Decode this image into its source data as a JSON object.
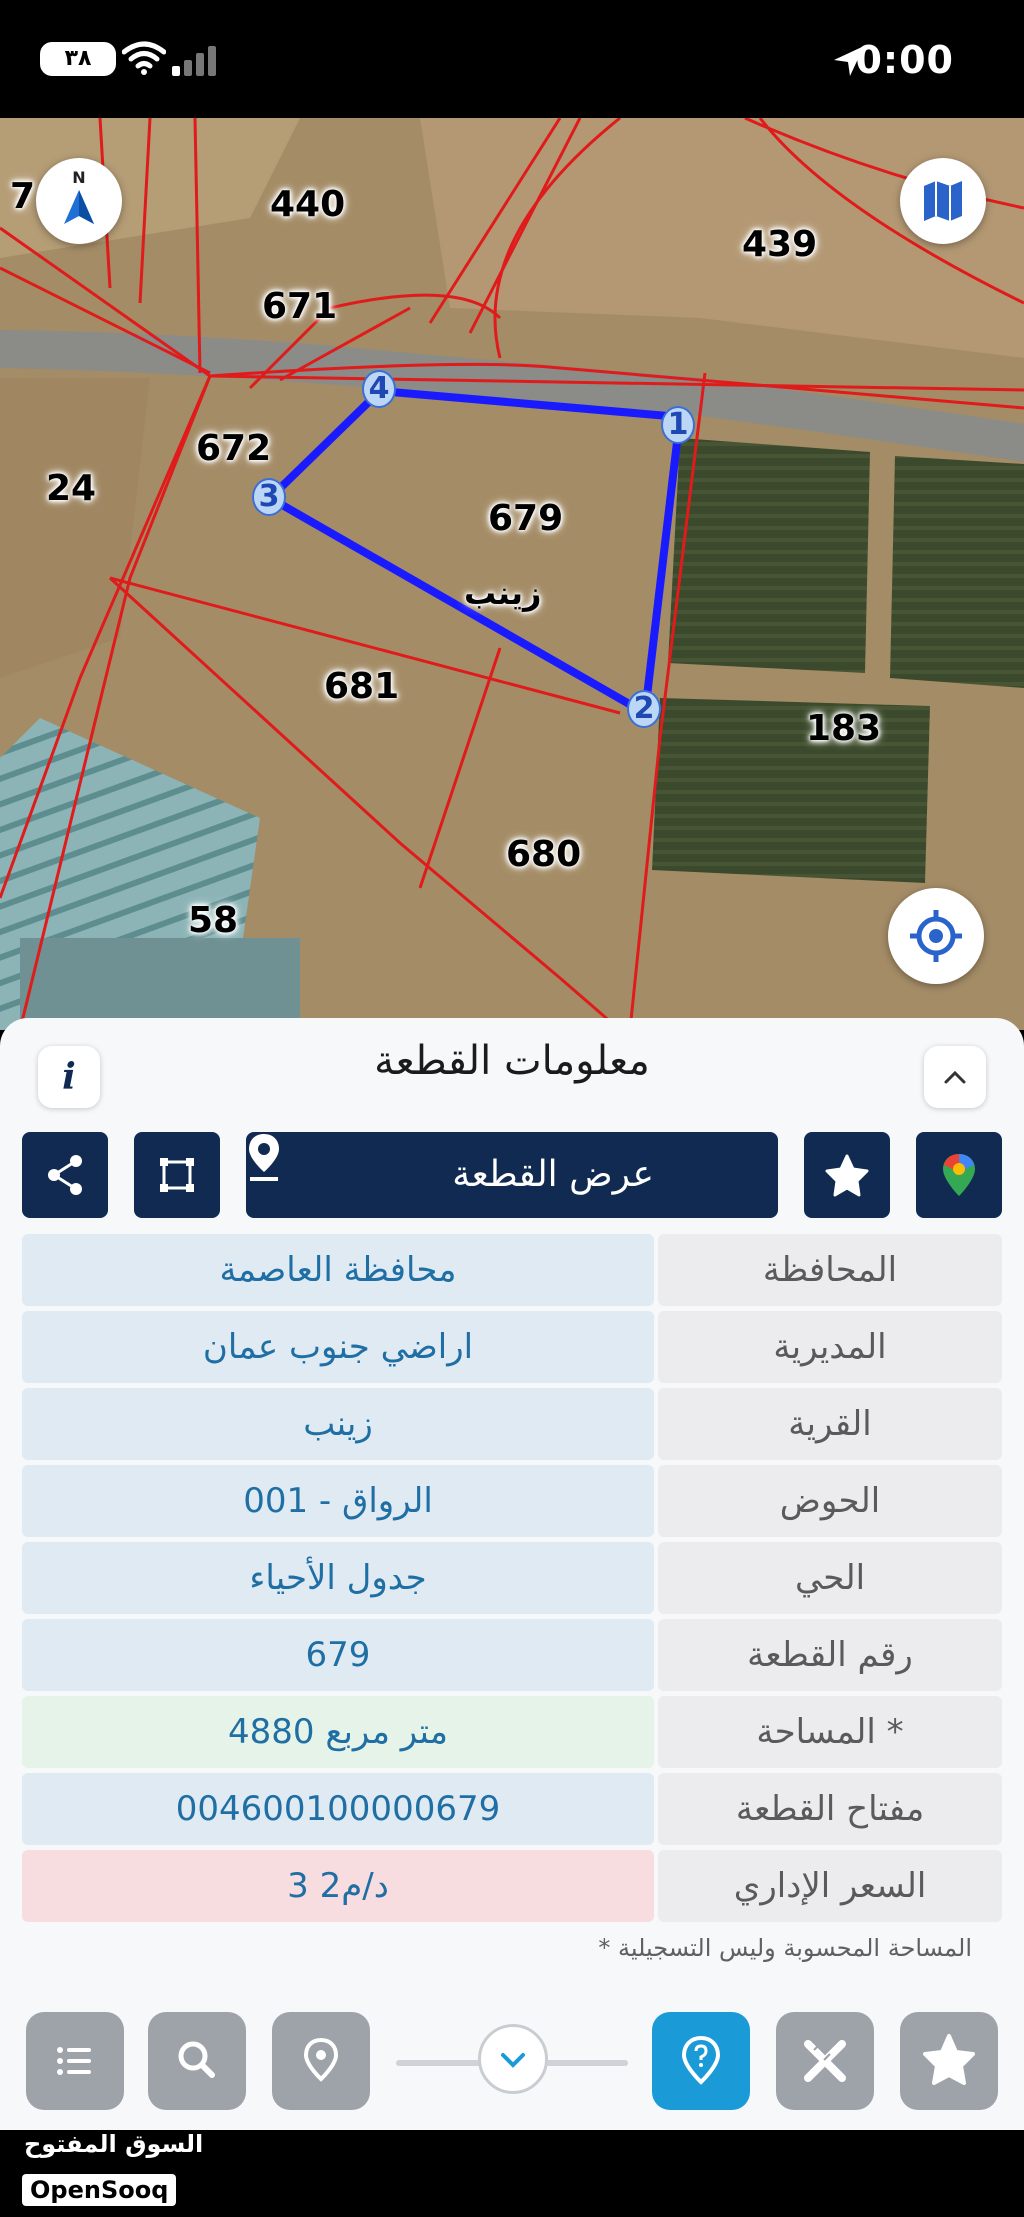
{
  "status_bar": {
    "time": "0:00",
    "battery": "٣٨",
    "icons": [
      "location-arrow-icon",
      "wifi-icon",
      "cellular-signal-icon",
      "battery-icon"
    ]
  },
  "map": {
    "parcel_labels": [
      "7",
      "440",
      "439",
      "671",
      "672",
      "24",
      "679",
      "زينب",
      "681",
      "183",
      "680",
      "58"
    ],
    "vertices": [
      "1",
      "2",
      "3",
      "4"
    ],
    "compass_letter": "N",
    "colors": {
      "boundary": "#e01b1b",
      "selection": "#1a1aff"
    }
  },
  "panel": {
    "title": "معلومات القطعة",
    "info_icon": "i",
    "show_parcel_label": "عرض القطعة",
    "rows": [
      {
        "label": "المحافظة",
        "value": "محافظة العاصمة",
        "style": "blue"
      },
      {
        "label": "المديرية",
        "value": "اراضي جنوب عمان",
        "style": "blue"
      },
      {
        "label": "القرية",
        "value": "زينب",
        "style": "blue"
      },
      {
        "label": "الحوض",
        "value": "الرواق - 001",
        "style": "blue"
      },
      {
        "label": "الحي",
        "value": "جدول الأحياء",
        "style": "blue"
      },
      {
        "label": "رقم القطعة",
        "value": "679",
        "style": "blue"
      },
      {
        "label": "المساحة *",
        "value": "4880   متر مربع",
        "style": "green"
      },
      {
        "label": "مفتاح القطعة",
        "value": "004600100000679",
        "style": "blue"
      },
      {
        "label": "السعر الإداري",
        "value": "3 د/م2",
        "style": "pink"
      }
    ],
    "footnote": "* المساحة المحسوبة وليس التسجيلية"
  },
  "toolbar": {
    "icons": [
      "list-icon",
      "search-icon",
      "location-pin-icon",
      "chevron-down-icon",
      "help-pin-icon",
      "measure-tools-icon",
      "favorite-star-icon"
    ]
  },
  "watermark": {
    "arabic": "السوق المفتوح",
    "english": "OpenSooq"
  }
}
